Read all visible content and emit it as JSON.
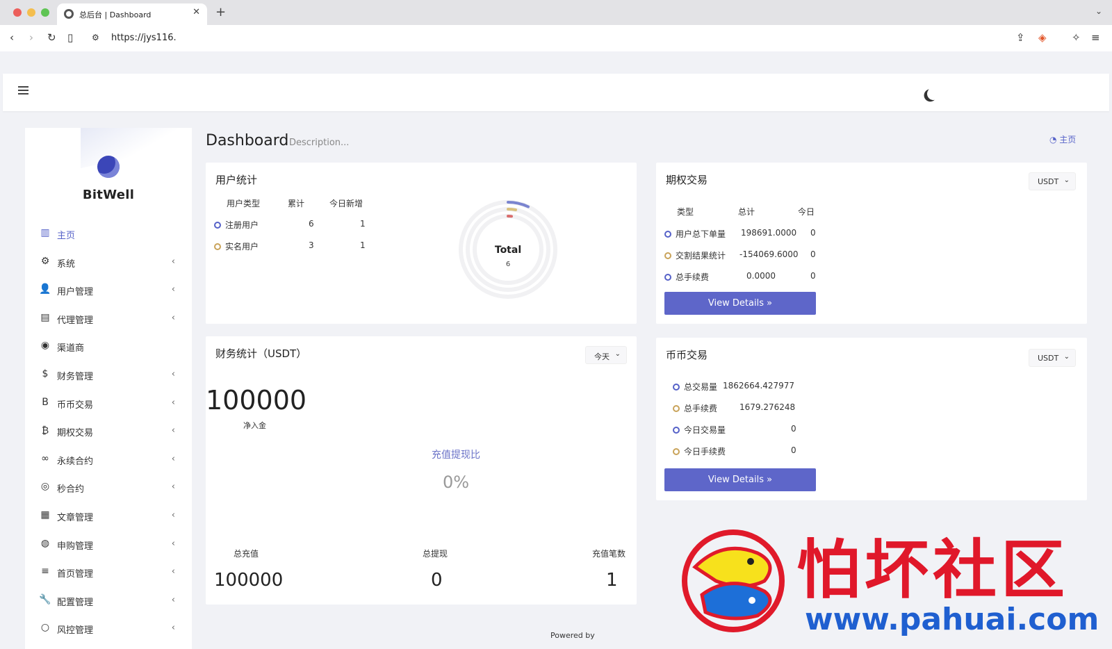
{
  "browser": {
    "tab_title": "总后台 | Dashboard",
    "url": "https://jys116."
  },
  "sidebar": {
    "brand": "BitWell",
    "items": [
      {
        "label": "主页",
        "icon": "bar-chart-icon",
        "glyph": "▥",
        "active": true,
        "has_children": false
      },
      {
        "label": "系统",
        "icon": "gear-icon",
        "glyph": "⚙",
        "has_children": true
      },
      {
        "label": "用户管理",
        "icon": "user-tie-icon",
        "glyph": "👤",
        "has_children": true
      },
      {
        "label": "代理管理",
        "icon": "id-card-icon",
        "glyph": "▤",
        "has_children": true
      },
      {
        "label": "渠道商",
        "icon": "user-circle-icon",
        "glyph": "◉",
        "has_children": false
      },
      {
        "label": "财务管理",
        "icon": "dollar-icon",
        "glyph": "$",
        "has_children": true
      },
      {
        "label": "币币交易",
        "icon": "letter-b-icon",
        "glyph": "B",
        "has_children": true
      },
      {
        "label": "期权交易",
        "icon": "bitcoin-icon",
        "glyph": "₿",
        "has_children": true
      },
      {
        "label": "永续合约",
        "icon": "link-icon",
        "glyph": "∞",
        "has_children": true
      },
      {
        "label": "秒合约",
        "icon": "dot-circle-icon",
        "glyph": "◎",
        "has_children": true
      },
      {
        "label": "文章管理",
        "icon": "newspaper-icon",
        "glyph": "▦",
        "has_children": true
      },
      {
        "label": "申购管理",
        "icon": "life-ring-icon",
        "glyph": "◍",
        "has_children": true
      },
      {
        "label": "首页管理",
        "icon": "list-icon",
        "glyph": "≡",
        "has_children": true
      },
      {
        "label": "配置管理",
        "icon": "wrench-icon",
        "glyph": "🔧",
        "has_children": true
      },
      {
        "label": "风控管理",
        "icon": "circle-icon",
        "glyph": "○",
        "has_children": true
      }
    ]
  },
  "header": {
    "title": "Dashboard",
    "description": "Description...",
    "breadcrumb": "主页"
  },
  "user_stats": {
    "title": "用户统计",
    "headers": [
      "用户类型",
      "累计",
      "今日新增"
    ],
    "rows": [
      {
        "type": "注册用户",
        "total": "6",
        "today": "1",
        "color": "#5561c8"
      },
      {
        "type": "实名用户",
        "total": "3",
        "today": "1",
        "color": "#c9a35a"
      }
    ],
    "donut": {
      "label": "Total",
      "value": "6"
    }
  },
  "options_trading": {
    "title": "期权交易",
    "currency": "USDT",
    "headers": [
      "类型",
      "总计",
      "今日"
    ],
    "rows": [
      {
        "type": "用户总下单量",
        "total": "198691.0000",
        "today": "0",
        "color": "#5561c8"
      },
      {
        "type": "交割结果统计",
        "total": "-154069.6000",
        "today": "0",
        "color": "#c9a35a"
      },
      {
        "type": "总手续费",
        "total": "0.0000",
        "today": "0",
        "color": "#5561c8"
      }
    ],
    "button": "View Details »"
  },
  "finance": {
    "title": "财务统计（USDT）",
    "period": "今天",
    "net_deposit": "100000",
    "net_deposit_label": "净入金",
    "ratio_label": "充值提现比",
    "ratio_value": "0%",
    "stats": [
      {
        "label": "总充值",
        "value": "100000"
      },
      {
        "label": "总提现",
        "value": "0"
      },
      {
        "label": "充值笔数",
        "value": "1"
      }
    ]
  },
  "spot_trading": {
    "title": "币币交易",
    "currency": "USDT",
    "rows": [
      {
        "label": "总交易量",
        "value": "1862664.427977",
        "color": "#5561c8"
      },
      {
        "label": "总手续费",
        "value": "1679.276248",
        "color": "#c9a35a"
      },
      {
        "label": "今日交易量",
        "value": "0",
        "color": "#5561c8"
      },
      {
        "label": "今日手续费",
        "value": "0",
        "color": "#c9a35a"
      }
    ],
    "button": "View Details »"
  },
  "footer": {
    "powered_by": "Powered by"
  },
  "watermark": {
    "cn_text": "怕坏社区",
    "url_text": "www.pahuai.com"
  }
}
